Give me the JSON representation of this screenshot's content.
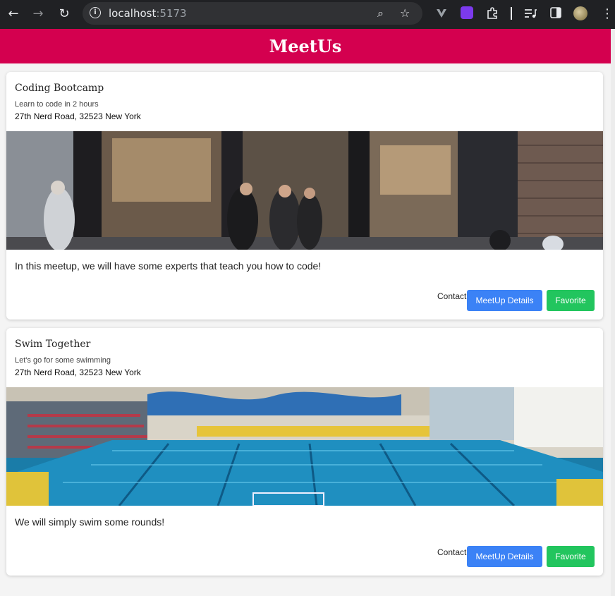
{
  "browser": {
    "url_host": "localhost",
    "url_port": ":5173",
    "back_glyph": "←",
    "forward_glyph": "→",
    "reload_glyph": "↻",
    "info_glyph": "i",
    "zoom_glyph": "⌕",
    "star_glyph": "☆",
    "menu_glyph": "⋮"
  },
  "app": {
    "title": "MeetUs",
    "accent": "#d4004f",
    "details_color": "#3b82f6",
    "favorite_color": "#22c55e"
  },
  "meetups": [
    {
      "title": "Coding Bootcamp",
      "subtitle": "Learn to code in 2 hours",
      "address": "27th Nerd Road, 32523 New York",
      "description": "In this meetup, we will have some experts that teach you how to code!",
      "contact_label": "Contact",
      "details_label": "MeetUp Details",
      "favorite_label": "Favorite"
    },
    {
      "title": "Swim Together",
      "subtitle": "Let's go for some swimming",
      "address": "27th Nerd Road, 32523 New York",
      "description": "We will simply swim some rounds!",
      "contact_label": "Contact",
      "details_label": "MeetUp Details",
      "favorite_label": "Favorite"
    }
  ]
}
